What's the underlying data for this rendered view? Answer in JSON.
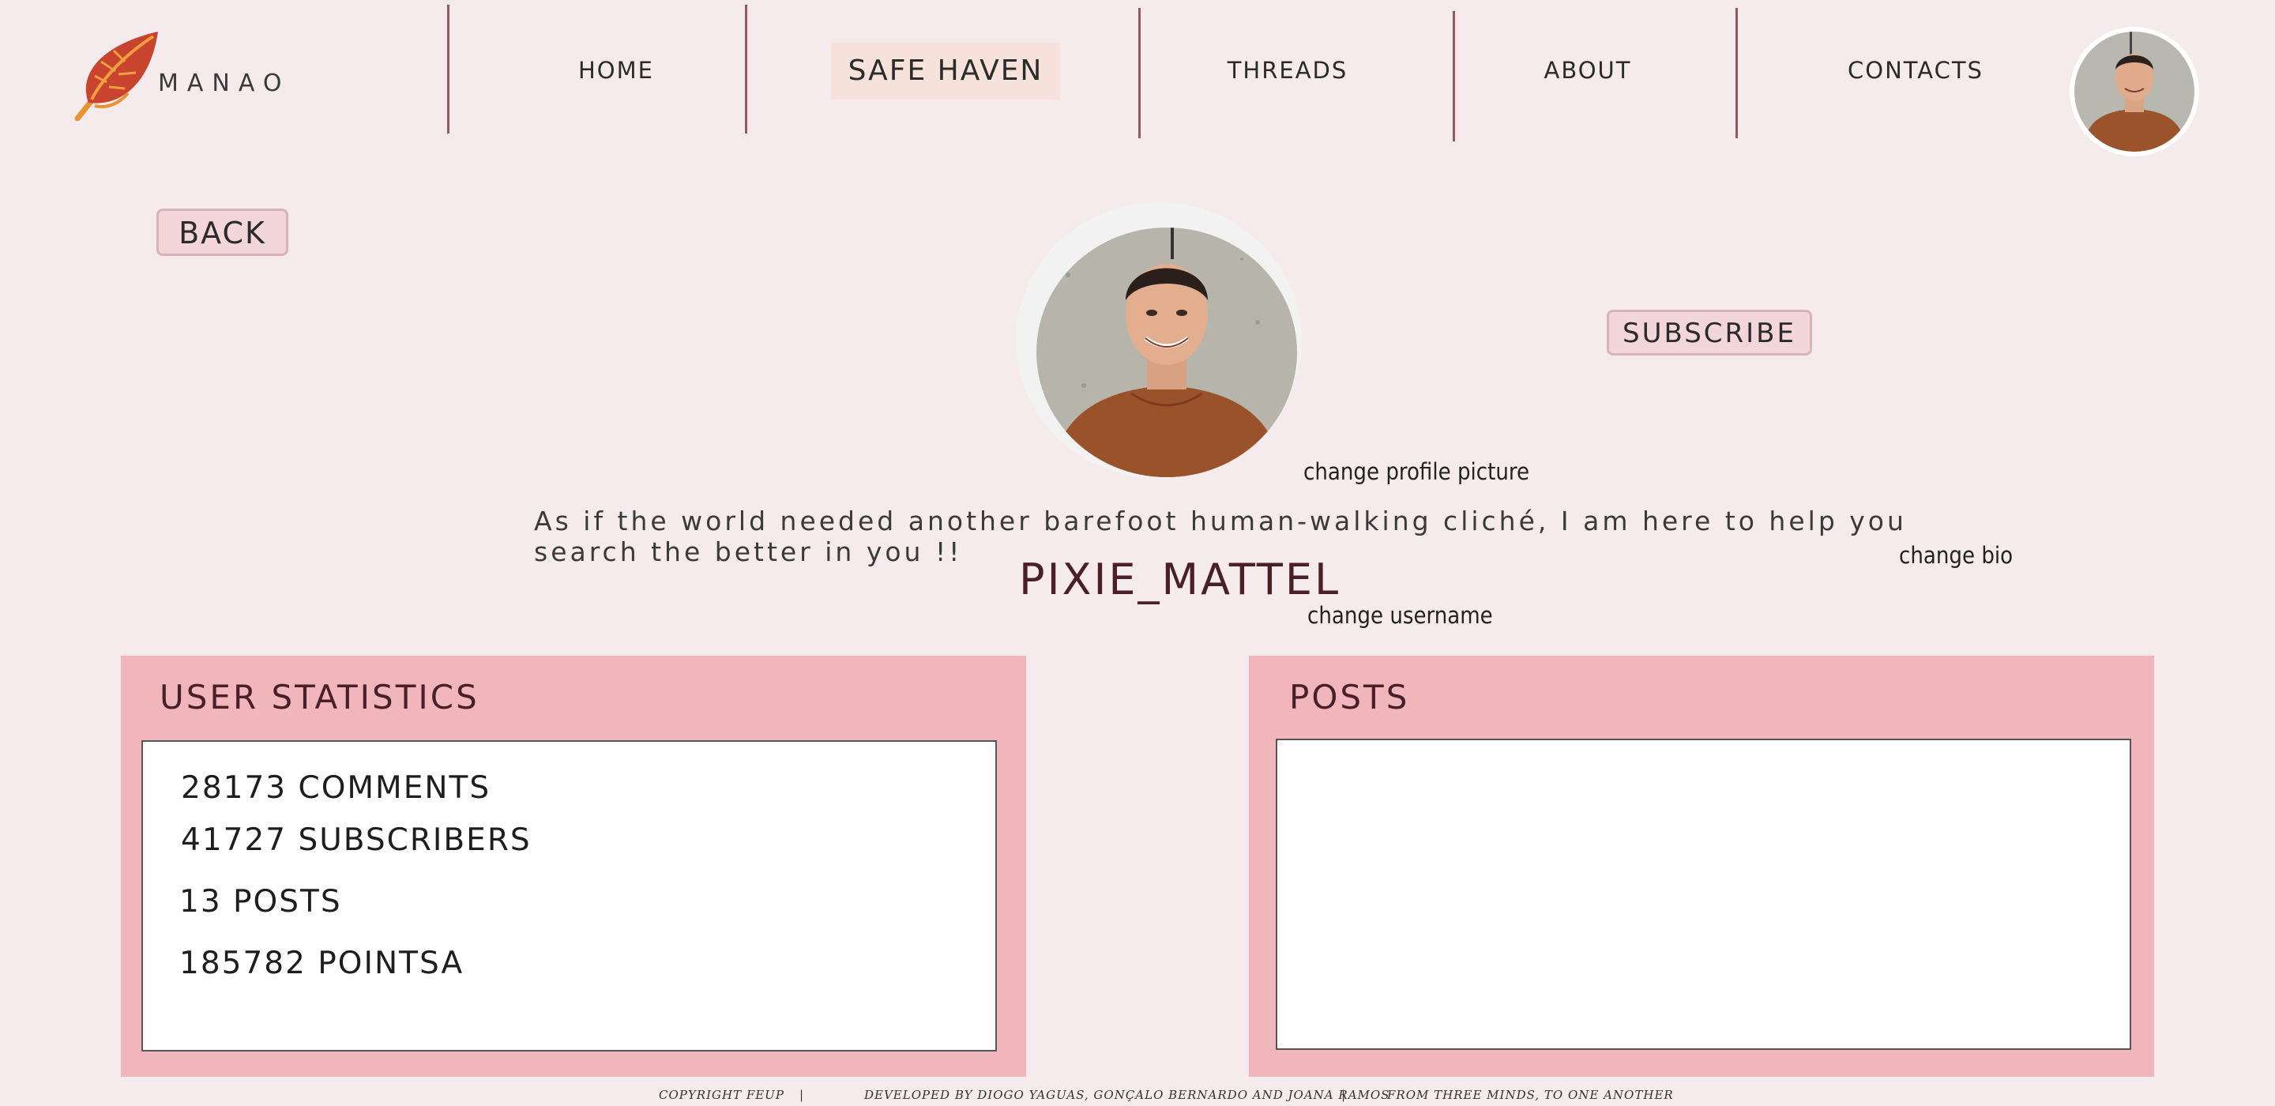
{
  "brand": {
    "name": "MANAO"
  },
  "nav": {
    "home": "HOME",
    "safe_haven": "SAFE  HAVEN",
    "threads": "THREADS",
    "about": "ABOUT",
    "contacts": "CONTACTS"
  },
  "actions": {
    "back": "BACK",
    "subscribe": "SUBSCRIBE",
    "change_picture": "change profile picture",
    "change_bio": "change bio",
    "change_username": "change username"
  },
  "profile": {
    "bio": "As if the world needed another barefoot human-walking cliché, I am here to help you search the better in you !!",
    "username": "PIXIE_MATTEL"
  },
  "stats_panel": {
    "title": "USER STATISTICS",
    "comments": "28173 COMMENTS",
    "subscribers": "41727 SUBSCRIBERS",
    "posts": "13 POSTS",
    "points": "185782 POINTSA"
  },
  "posts_panel": {
    "title": "POSTS"
  },
  "footer": {
    "copyright": "COPYRIGHT FEUP",
    "developed": "DEVELOPED BY DIOGO YAGUAS, GONÇALO BERNARDO AND JOANA RAMOS",
    "tagline": "FROM THREE MINDS, TO ONE ANOTHER",
    "separator": "|"
  },
  "colors": {
    "background": "#f5eaec",
    "panel": "#f1b5bc",
    "nav_active": "#f6e2da",
    "divider": "#8f5a62",
    "button": "#f2d6da",
    "title": "#4a2028"
  },
  "icons": {
    "logo": "leaf-logo-icon"
  }
}
